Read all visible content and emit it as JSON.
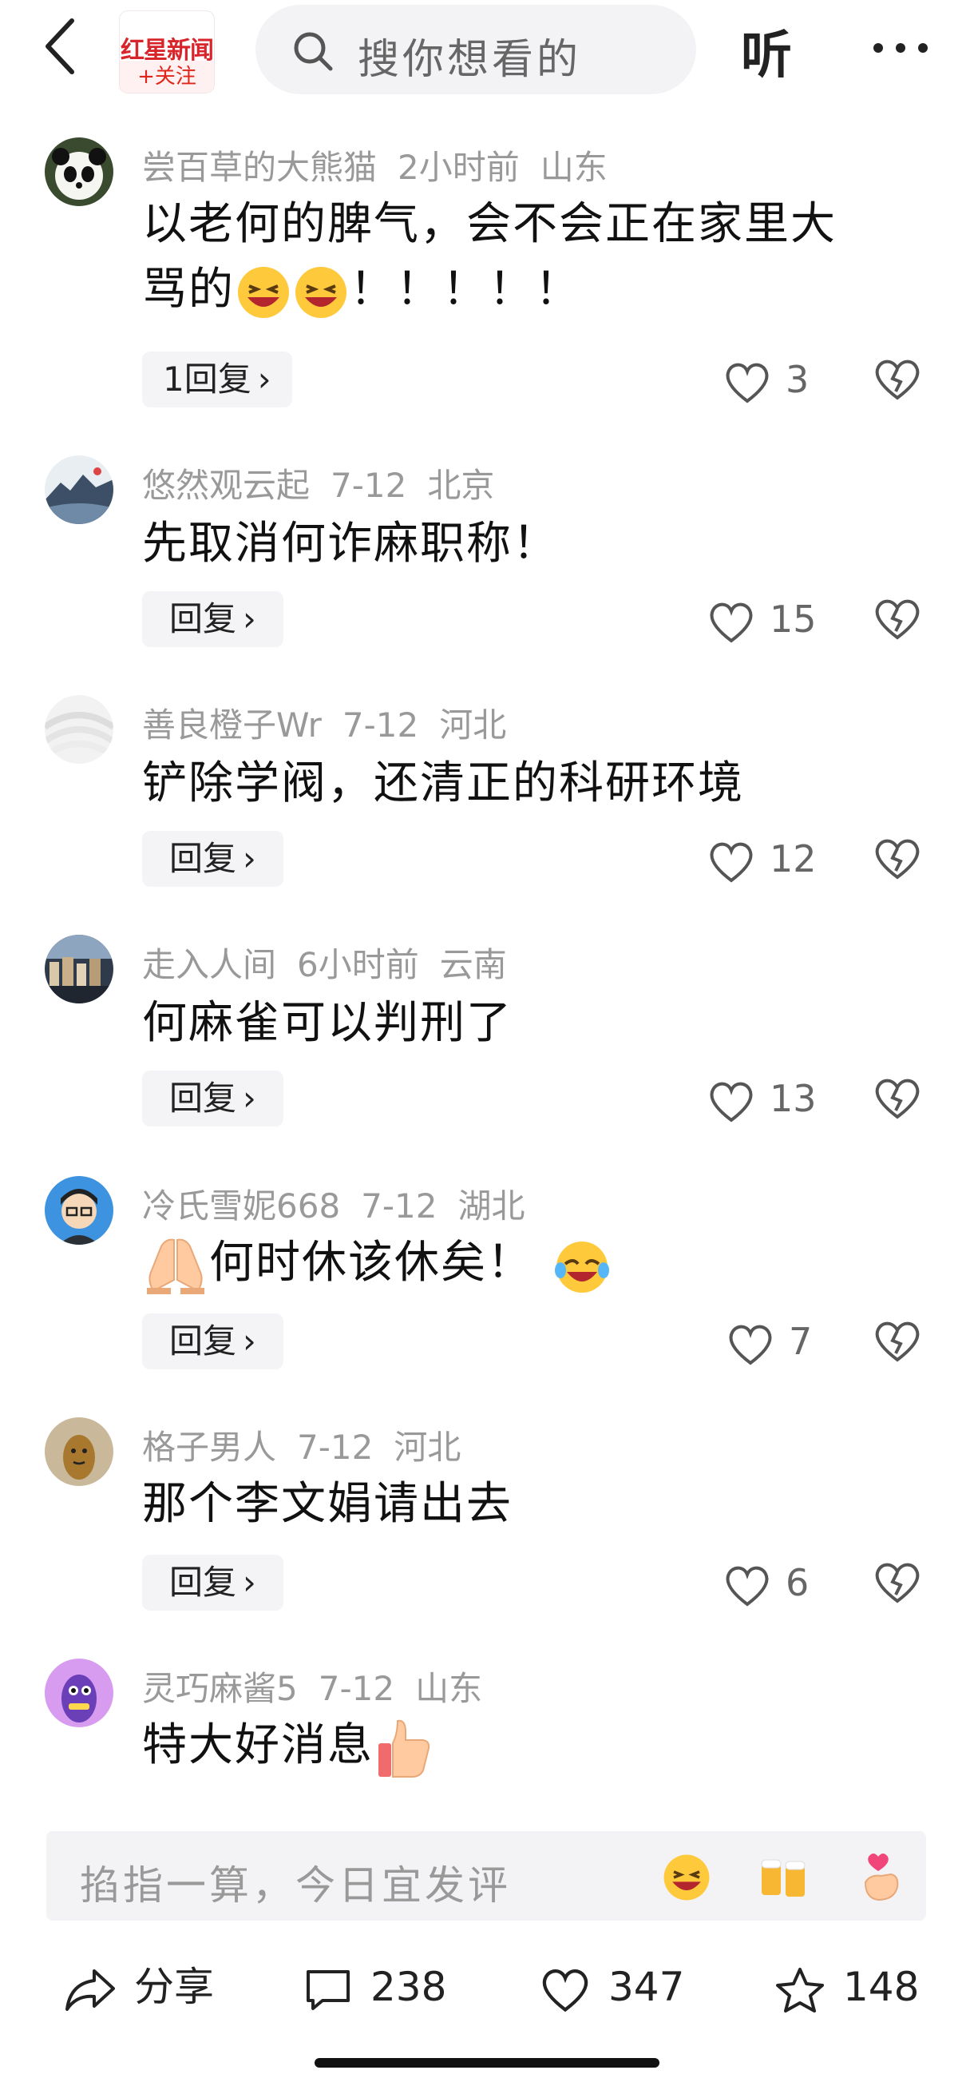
{
  "header": {
    "brand": "红星新闻",
    "follow": "+关注",
    "search_placeholder": "搜你想看的",
    "listen": "听"
  },
  "comments": [
    {
      "user": "尝百草的大熊猫",
      "time": "2小时前",
      "location": "山东",
      "line1": "以老何的脾气，会不会正在家里大",
      "line2": "骂的",
      "line2_tail": "！！！！！",
      "reply": "1回复",
      "likes": "3"
    },
    {
      "user": "悠然观云起",
      "time": "7-12",
      "location": "北京",
      "line1": "先取消何诈麻职称！",
      "reply": "回复",
      "likes": "15"
    },
    {
      "user": "善良橙子Wr",
      "time": "7-12",
      "location": "河北",
      "line1": "铲除学阀，还清正的科研环境",
      "reply": "回复",
      "likes": "12"
    },
    {
      "user": "走入人间",
      "time": "6小时前",
      "location": "云南",
      "line1": "何麻雀可以判刑了",
      "reply": "回复",
      "likes": "13"
    },
    {
      "user": "冷氏雪妮668",
      "time": "7-12",
      "location": "湖北",
      "line1": "何时休该休矣！",
      "reply": "回复",
      "likes": "7"
    },
    {
      "user": "格子男人",
      "time": "7-12",
      "location": "河北",
      "line1": "那个李文娟请出去",
      "reply": "回复",
      "likes": "6"
    },
    {
      "user": "灵巧麻酱5",
      "time": "7-12",
      "location": "山东",
      "line1": "特大好消息"
    }
  ],
  "input": {
    "placeholder": "掐指一算，今日宜发评"
  },
  "bottom": {
    "share": "分享",
    "comments": "238",
    "likes": "347",
    "favorites": "148"
  },
  "colors": {
    "brand_red": "#d8252b",
    "meta_gray": "#999999",
    "bg": "#ffffff",
    "chip_bg": "#f4f4f6"
  }
}
